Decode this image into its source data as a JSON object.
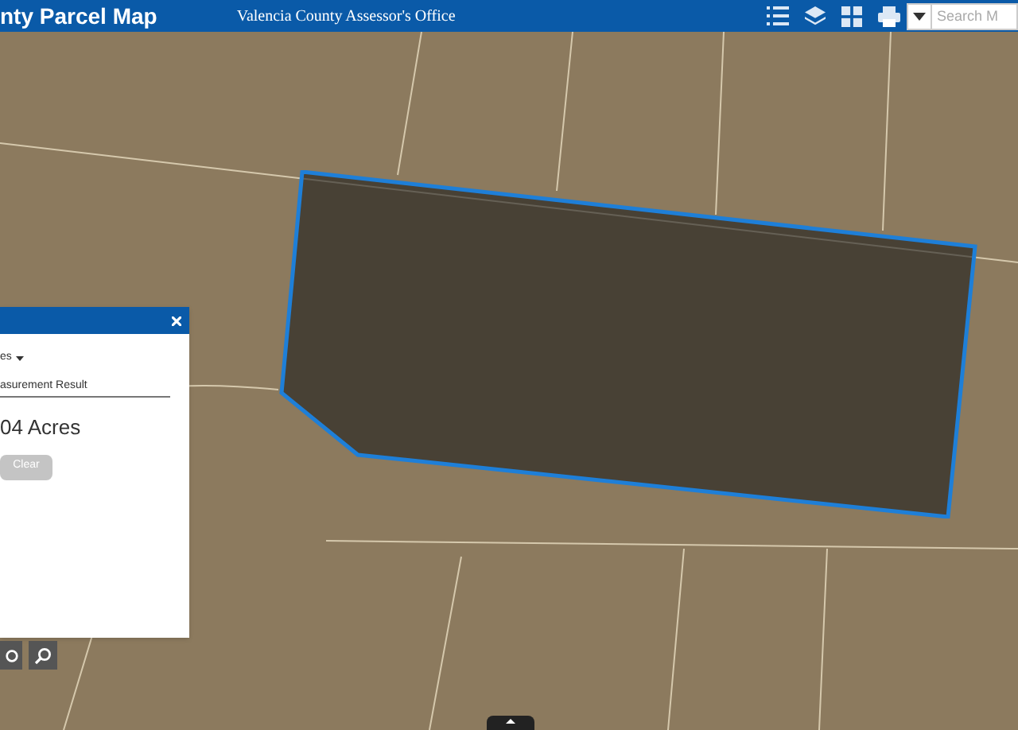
{
  "header": {
    "title": "nty Parcel Map",
    "subtitle": "Valencia County Assessor's Office",
    "search": {
      "placeholder": "Search M"
    }
  },
  "measure_panel": {
    "unit": "es",
    "result_label": "asurement Result",
    "result": "04 Acres",
    "clear_button": {
      "label": "Clear",
      "disabled": true
    }
  }
}
